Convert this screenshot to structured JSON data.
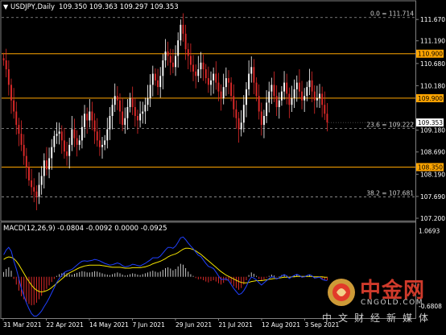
{
  "chart_data": [
    {
      "type": "candlestick",
      "symbol_header": "USDJPY,Daily",
      "ohlc_header": "109.350 109.363 109.297 109.353",
      "ylim": [
        107.2,
        111.8
      ],
      "y_ticks": [
        "111.670",
        "111.190",
        "110.680",
        "110.180",
        "109.180",
        "108.690",
        "108.190",
        "107.690",
        "107.200"
      ],
      "y_tick_values": [
        111.67,
        111.19,
        110.68,
        110.18,
        109.18,
        108.69,
        108.19,
        107.69,
        107.2
      ],
      "x_ticks": [
        "31 Mar 2021",
        "22 Apr 2021",
        "14 May 2021",
        "7 Jun 2021",
        "29 Jun 2021",
        "21 Jul 2021",
        "12 Aug 2021",
        "3 Sep 2021"
      ],
      "levels": [
        {
          "value": 110.9,
          "label": "110.900",
          "color": "#ffa500"
        },
        {
          "value": 109.9,
          "label": "109.900",
          "color": "#ffa500"
        },
        {
          "value": 108.35,
          "label": "108.350",
          "color": "#ffa500"
        }
      ],
      "fibo": [
        {
          "value": 111.714,
          "label": "0.0 = 111.714"
        },
        {
          "value": 109.222,
          "label": "23.6 = 109.222"
        },
        {
          "value": 107.681,
          "label": "38.2 = 107.681"
        }
      ],
      "current_price": {
        "value": 109.353,
        "label": "109.353"
      },
      "closes": [
        110.75,
        110.55,
        110.2,
        109.85,
        109.6,
        109.3,
        109.1,
        108.85,
        108.6,
        108.35,
        108.05,
        107.9,
        107.8,
        107.68,
        107.95,
        108.15,
        108.5,
        108.3,
        108.55,
        108.8,
        109.05,
        109.1,
        109.15,
        108.95,
        108.7,
        108.6,
        108.85,
        109.2,
        109.0,
        108.85,
        108.95,
        109.25,
        109.55,
        109.4,
        109.6,
        109.4,
        109.15,
        108.95,
        108.8,
        108.85,
        108.95,
        109.2,
        109.5,
        109.75,
        109.95,
        109.85,
        109.6,
        109.3,
        109.45,
        109.7,
        109.9,
        109.7,
        109.5,
        109.4,
        109.55,
        109.6,
        109.75,
        109.9,
        110.2,
        110.45,
        110.3,
        110.15,
        110.4,
        110.75,
        110.95,
        110.85,
        110.7,
        110.6,
        110.85,
        111.2,
        111.55,
        111.35,
        111.0,
        110.85,
        110.65,
        110.5,
        110.4,
        110.55,
        110.7,
        110.55,
        110.35,
        110.2,
        110.3,
        110.45,
        110.25,
        110.05,
        109.9,
        110.15,
        110.35,
        110.25,
        109.95,
        109.65,
        109.45,
        109.2,
        109.35,
        109.75,
        110.1,
        110.45,
        110.6,
        110.25,
        109.95,
        109.6,
        109.3,
        109.5,
        109.8,
        110.05,
        110.2,
        109.95,
        109.7,
        109.85,
        110.05,
        110.25,
        110.0,
        109.75,
        109.9,
        110.1,
        110.25,
        110.05,
        109.85,
        109.95,
        110.15,
        110.3,
        110.05,
        109.85,
        109.9,
        110.0,
        109.75,
        109.55,
        109.353
      ]
    },
    {
      "type": "line",
      "indicator_header": "MACD(12,26,9) -0.0804 -0.0092 0.0000 -0.0925",
      "y_ticks": [
        "1.0693",
        "-0.6808"
      ],
      "y_tick_values": [
        1.0693,
        -0.6808
      ],
      "ylim": [
        -0.9,
        1.15
      ],
      "series": [
        {
          "role": "histogram",
          "color": "#c8c8c8",
          "neg_color": "#e02a2a",
          "values": [
            0.11,
            0.18,
            0.22,
            0.14,
            -0.05,
            -0.18,
            -0.32,
            -0.45,
            -0.52,
            -0.58,
            -0.63,
            -0.66,
            -0.65,
            -0.6,
            -0.52,
            -0.44,
            -0.35,
            -0.28,
            -0.2,
            -0.12,
            -0.05,
            0.02,
            0.06,
            0.08,
            0.1,
            0.08,
            0.06,
            0.05,
            0.07,
            0.09,
            0.11,
            0.13,
            0.12,
            0.1,
            0.1,
            0.11,
            0.13,
            0.12,
            0.1,
            0.08,
            0.06,
            0.05,
            0.04,
            0.06,
            0.08,
            0.1,
            0.08,
            0.05,
            0.03,
            0.04,
            0.06,
            0.08,
            0.07,
            0.05,
            0.04,
            0.06,
            0.08,
            0.1,
            0.12,
            0.14,
            0.12,
            0.1,
            0.12,
            0.16,
            0.2,
            0.22,
            0.19,
            0.15,
            0.18,
            0.24,
            0.3,
            0.28,
            0.2,
            0.12,
            0.06,
            0.02,
            -0.03,
            -0.06,
            -0.05,
            -0.08,
            -0.11,
            -0.13,
            -0.1,
            -0.08,
            -0.11,
            -0.15,
            -0.18,
            -0.14,
            -0.09,
            -0.1,
            -0.16,
            -0.22,
            -0.26,
            -0.3,
            -0.26,
            -0.18,
            -0.08,
            0.04,
            0.1,
            0.07,
            0.02,
            -0.05,
            -0.1,
            -0.06,
            -0.02,
            0.02,
            0.05,
            0.03,
            -0.01,
            0.01,
            0.04,
            0.06,
            0.03,
            -0.02,
            0.0,
            0.03,
            0.05,
            0.02,
            -0.02,
            -0.01,
            0.02,
            0.04,
            0.01,
            -0.03,
            -0.02,
            -0.01,
            -0.05,
            -0.07,
            -0.08
          ]
        },
        {
          "role": "signal",
          "color": "#f2e200",
          "values": [
            0.4,
            0.44,
            0.46,
            0.45,
            0.42,
            0.36,
            0.28,
            0.18,
            0.08,
            -0.02,
            -0.11,
            -0.19,
            -0.26,
            -0.31,
            -0.34,
            -0.35,
            -0.34,
            -0.32,
            -0.29,
            -0.25,
            -0.2,
            -0.15,
            -0.1,
            -0.05,
            0.0,
            0.05,
            0.09,
            0.12,
            0.15,
            0.18,
            0.21,
            0.23,
            0.25,
            0.26,
            0.27,
            0.27,
            0.27,
            0.27,
            0.27,
            0.26,
            0.25,
            0.24,
            0.23,
            0.22,
            0.22,
            0.22,
            0.22,
            0.21,
            0.2,
            0.2,
            0.2,
            0.21,
            0.21,
            0.21,
            0.21,
            0.22,
            0.23,
            0.25,
            0.27,
            0.3,
            0.32,
            0.34,
            0.36,
            0.39,
            0.42,
            0.46,
            0.49,
            0.51,
            0.53,
            0.56,
            0.6,
            0.64,
            0.66,
            0.66,
            0.65,
            0.63,
            0.6,
            0.56,
            0.52,
            0.47,
            0.42,
            0.37,
            0.32,
            0.27,
            0.22,
            0.17,
            0.12,
            0.08,
            0.04,
            0.01,
            -0.02,
            -0.05,
            -0.08,
            -0.11,
            -0.13,
            -0.14,
            -0.14,
            -0.13,
            -0.11,
            -0.1,
            -0.09,
            -0.09,
            -0.09,
            -0.08,
            -0.07,
            -0.06,
            -0.05,
            -0.04,
            -0.04,
            -0.03,
            -0.02,
            -0.01,
            -0.01,
            -0.01,
            0.0,
            0.0,
            0.01,
            0.01,
            0.01,
            0.01,
            0.01,
            0.01,
            0.01,
            0.0,
            0.0,
            0.0,
            0.0,
            -0.01,
            -0.01
          ]
        },
        {
          "role": "macd",
          "color": "#2040ff",
          "values": [
            0.51,
            0.62,
            0.68,
            0.59,
            0.37,
            0.18,
            -0.04,
            -0.27,
            -0.44,
            -0.6,
            -0.74,
            -0.85,
            -0.91,
            -0.91,
            -0.86,
            -0.79,
            -0.69,
            -0.6,
            -0.49,
            -0.37,
            -0.25,
            -0.13,
            -0.04,
            0.03,
            0.1,
            0.13,
            0.15,
            0.17,
            0.22,
            0.27,
            0.32,
            0.36,
            0.37,
            0.36,
            0.37,
            0.38,
            0.4,
            0.39,
            0.37,
            0.34,
            0.31,
            0.29,
            0.27,
            0.28,
            0.3,
            0.32,
            0.3,
            0.26,
            0.23,
            0.24,
            0.26,
            0.29,
            0.28,
            0.26,
            0.25,
            0.28,
            0.31,
            0.35,
            0.39,
            0.44,
            0.44,
            0.44,
            0.48,
            0.55,
            0.62,
            0.68,
            0.68,
            0.66,
            0.71,
            0.8,
            0.9,
            0.92,
            0.86,
            0.78,
            0.71,
            0.65,
            0.57,
            0.5,
            0.47,
            0.39,
            0.31,
            0.24,
            0.22,
            0.19,
            0.11,
            0.02,
            -0.06,
            -0.06,
            -0.05,
            -0.09,
            -0.18,
            -0.27,
            -0.34,
            -0.41,
            -0.39,
            -0.32,
            -0.22,
            -0.09,
            -0.01,
            -0.03,
            -0.07,
            -0.14,
            -0.19,
            -0.14,
            -0.09,
            -0.04,
            0.0,
            -0.01,
            -0.05,
            -0.02,
            0.02,
            0.05,
            0.02,
            -0.04,
            0.0,
            0.03,
            0.06,
            0.03,
            -0.01,
            0.0,
            0.03,
            0.05,
            0.02,
            -0.03,
            -0.02,
            -0.01,
            -0.06,
            -0.08,
            -0.09
          ]
        }
      ]
    }
  ],
  "watermark": {
    "name": "中金网",
    "domain": "CNGOLD.COM",
    "sub": "中文财经新媒体"
  }
}
